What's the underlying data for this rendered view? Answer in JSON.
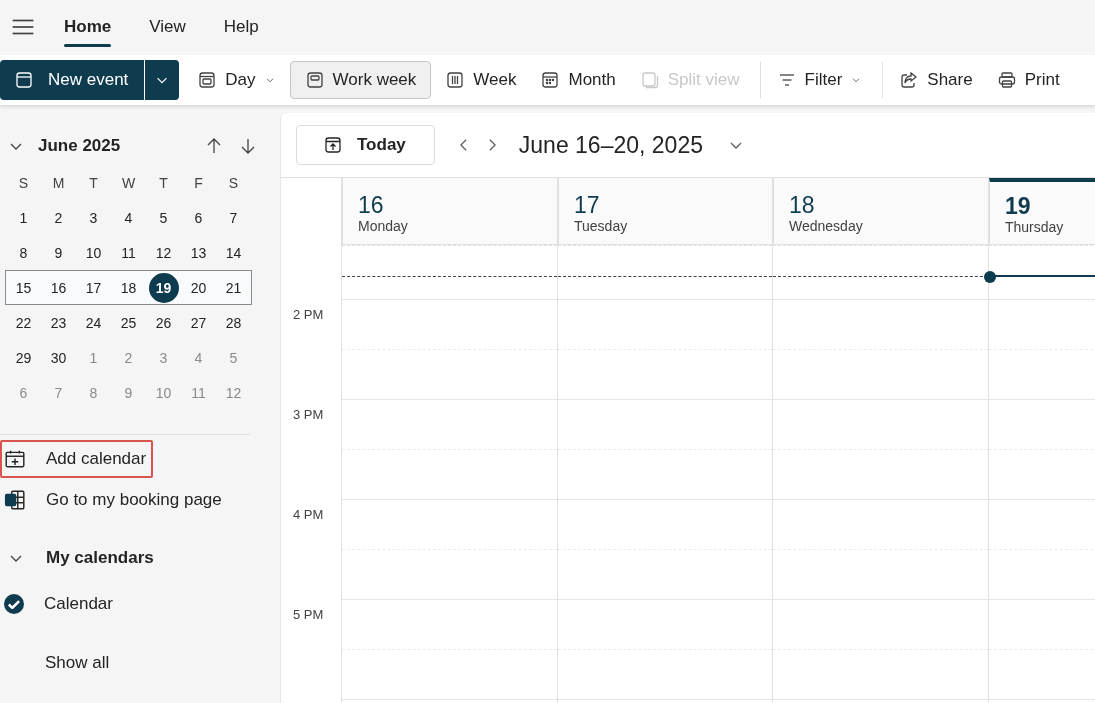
{
  "menu_tabs": [
    {
      "label": "Home",
      "selected": true
    },
    {
      "label": "View",
      "selected": false
    },
    {
      "label": "Help",
      "selected": false
    }
  ],
  "toolbar": {
    "new_event": "New event",
    "views": [
      {
        "label": "Day",
        "selected": false,
        "disabled": false,
        "dropdown": true
      },
      {
        "label": "Work week",
        "selected": true,
        "disabled": false,
        "dropdown": false
      },
      {
        "label": "Week",
        "selected": false,
        "disabled": false,
        "dropdown": false
      },
      {
        "label": "Month",
        "selected": false,
        "disabled": false,
        "dropdown": false
      },
      {
        "label": "Split view",
        "selected": false,
        "disabled": true,
        "dropdown": false
      }
    ],
    "filter": "Filter",
    "share": "Share",
    "print": "Print"
  },
  "mini_calendar": {
    "month": "June 2025",
    "expanded": true,
    "weekdays": [
      "S",
      "M",
      "T",
      "W",
      "T",
      "F",
      "S"
    ],
    "weeks": [
      {
        "selected": false,
        "days": [
          {
            "label": "1",
            "in_month": true,
            "today": false
          },
          {
            "label": "2",
            "in_month": true,
            "today": false
          },
          {
            "label": "3",
            "in_month": true,
            "today": false
          },
          {
            "label": "4",
            "in_month": true,
            "today": false
          },
          {
            "label": "5",
            "in_month": true,
            "today": false
          },
          {
            "label": "6",
            "in_month": true,
            "today": false
          },
          {
            "label": "7",
            "in_month": true,
            "today": false
          }
        ]
      },
      {
        "selected": false,
        "days": [
          {
            "label": "8",
            "in_month": true,
            "today": false
          },
          {
            "label": "9",
            "in_month": true,
            "today": false
          },
          {
            "label": "10",
            "in_month": true,
            "today": false
          },
          {
            "label": "11",
            "in_month": true,
            "today": false
          },
          {
            "label": "12",
            "in_month": true,
            "today": false
          },
          {
            "label": "13",
            "in_month": true,
            "today": false
          },
          {
            "label": "14",
            "in_month": true,
            "today": false
          }
        ]
      },
      {
        "selected": true,
        "days": [
          {
            "label": "15",
            "in_month": true,
            "today": false
          },
          {
            "label": "16",
            "in_month": true,
            "today": false
          },
          {
            "label": "17",
            "in_month": true,
            "today": false
          },
          {
            "label": "18",
            "in_month": true,
            "today": false
          },
          {
            "label": "19",
            "in_month": true,
            "today": true
          },
          {
            "label": "20",
            "in_month": true,
            "today": false
          },
          {
            "label": "21",
            "in_month": true,
            "today": false
          }
        ]
      },
      {
        "selected": false,
        "days": [
          {
            "label": "22",
            "in_month": true,
            "today": false
          },
          {
            "label": "23",
            "in_month": true,
            "today": false
          },
          {
            "label": "24",
            "in_month": true,
            "today": false
          },
          {
            "label": "25",
            "in_month": true,
            "today": false
          },
          {
            "label": "26",
            "in_month": true,
            "today": false
          },
          {
            "label": "27",
            "in_month": true,
            "today": false
          },
          {
            "label": "28",
            "in_month": true,
            "today": false
          }
        ]
      },
      {
        "selected": false,
        "days": [
          {
            "label": "29",
            "in_month": true,
            "today": false
          },
          {
            "label": "30",
            "in_month": true,
            "today": false
          },
          {
            "label": "1",
            "in_month": false,
            "today": false
          },
          {
            "label": "2",
            "in_month": false,
            "today": false
          },
          {
            "label": "3",
            "in_month": false,
            "today": false
          },
          {
            "label": "4",
            "in_month": false,
            "today": false
          },
          {
            "label": "5",
            "in_month": false,
            "today": false
          }
        ]
      },
      {
        "selected": false,
        "days": [
          {
            "label": "6",
            "in_month": false,
            "today": false
          },
          {
            "label": "7",
            "in_month": false,
            "today": false
          },
          {
            "label": "8",
            "in_month": false,
            "today": false
          },
          {
            "label": "9",
            "in_month": false,
            "today": false
          },
          {
            "label": "10",
            "in_month": false,
            "today": false
          },
          {
            "label": "11",
            "in_month": false,
            "today": false
          },
          {
            "label": "12",
            "in_month": false,
            "today": false
          }
        ]
      }
    ]
  },
  "sidebar_links": [
    {
      "label": "Add calendar",
      "highlighted": true
    },
    {
      "label": "Go to my booking page",
      "highlighted": false
    }
  ],
  "my_calendars": {
    "title": "My calendars",
    "expanded": true,
    "calendars": [
      {
        "label": "Calendar",
        "checked": true
      }
    ],
    "show_all": "Show all"
  },
  "calendar_view": {
    "today_button": "Today",
    "range": "June 16–20, 2025",
    "days": [
      {
        "number": "16",
        "name": "Monday",
        "today": false
      },
      {
        "number": "17",
        "name": "Tuesday",
        "today": false
      },
      {
        "number": "18",
        "name": "Wednesday",
        "today": false
      },
      {
        "number": "19",
        "name": "Thursday",
        "today": true
      }
    ],
    "hours": [
      "2 PM",
      "3 PM",
      "4 PM",
      "5 PM"
    ]
  }
}
